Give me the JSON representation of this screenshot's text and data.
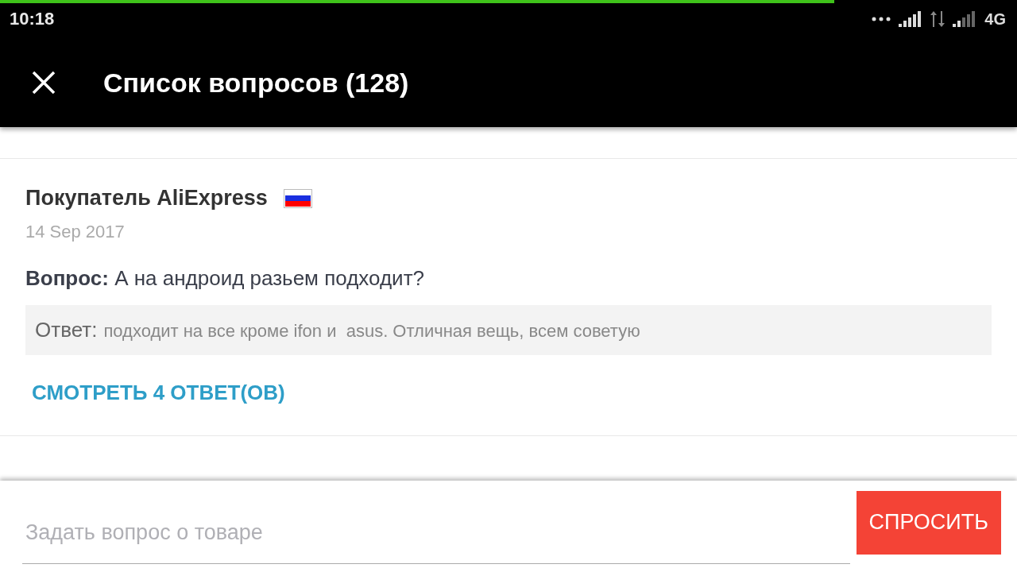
{
  "status_bar": {
    "time": "10:18",
    "network": "4G",
    "loading_bar": {
      "level": 0.82
    }
  },
  "toolbar": {
    "title": "Список вопросов (128)"
  },
  "questions": [
    {
      "author": "Покупатель AliExpress",
      "date": "14 Sep 2017",
      "question": "**Вопрос:** А на андроид разьем подходит?",
      "answer_label": "Ответ:",
      "answer": "подходит на все кроме ifon и  asus. Отличная вещь, всем советую",
      "more_link": "СМОТРЕТЬ 4 ОТВЕТ(ОВ)"
    }
  ],
  "ask_bar": {
    "placeholder": "Задать вопрос о товаре",
    "button": "СПРОСИТЬ"
  }
}
